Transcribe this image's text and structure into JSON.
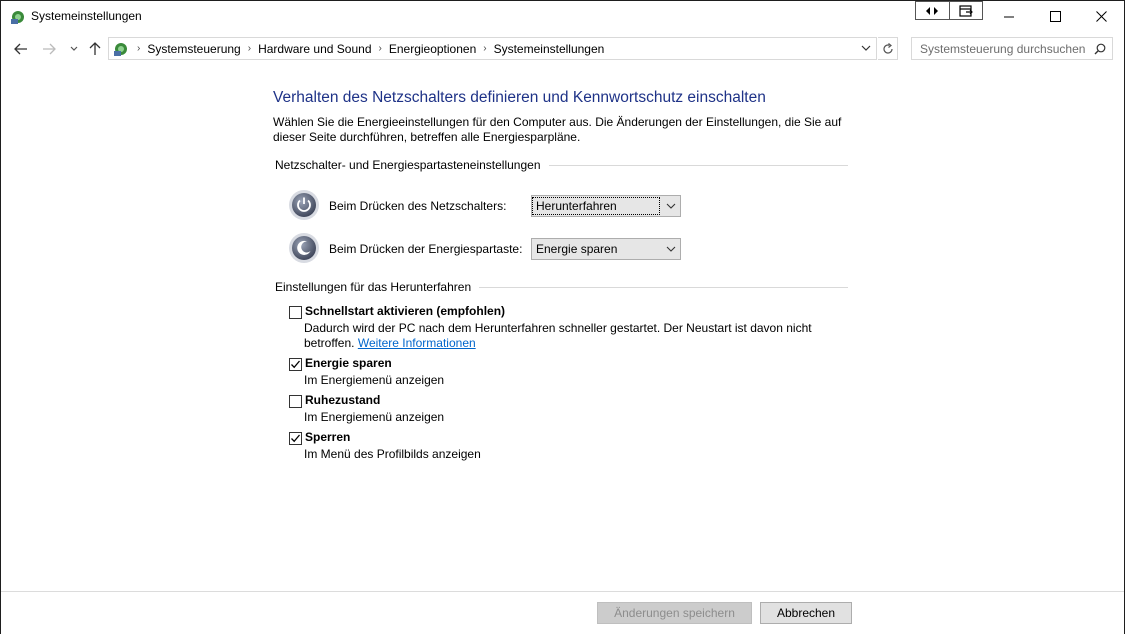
{
  "window": {
    "title": "Systemeinstellungen"
  },
  "address_bar": {
    "breadcrumbs": [
      "Systemsteuerung",
      "Hardware und Sound",
      "Energieoptionen",
      "Systemeinstellungen"
    ],
    "search_placeholder": "Systemsteuerung durchsuchen"
  },
  "main": {
    "title": "Verhalten des Netzschalters definieren und Kennwortschutz einschalten",
    "description": "Wählen Sie die Energieeinstellungen für den Computer aus. Die Änderungen der Einstellungen, die Sie auf dieser Seite durchführen, betreffen alle Energiesparpläne.",
    "power_section": {
      "heading": "Netzschalter- und Energiespartasteneinstellungen",
      "rows": [
        {
          "label": "Beim Drücken des Netzschalters:",
          "value": "Herunterfahren"
        },
        {
          "label": "Beim Drücken der Energiespartaste:",
          "value": "Energie sparen"
        }
      ]
    },
    "shutdown_section": {
      "heading": "Einstellungen für das Herunterfahren",
      "items": [
        {
          "label": "Schnellstart aktivieren (empfohlen)",
          "description": "Dadurch wird der PC nach dem Herunterfahren schneller gestartet. Der Neustart ist davon nicht betroffen.",
          "link": "Weitere Informationen",
          "checked": false
        },
        {
          "label": "Energie sparen",
          "description": "Im Energiemenü anzeigen",
          "checked": true
        },
        {
          "label": "Ruhezustand",
          "description": "Im Energiemenü anzeigen",
          "checked": false
        },
        {
          "label": "Sperren",
          "description": "Im Menü des Profilbilds anzeigen",
          "checked": true
        }
      ]
    }
  },
  "footer": {
    "save_label": "Änderungen speichern",
    "cancel_label": "Abbrechen"
  },
  "colors": {
    "title_blue": "#1e3287",
    "link_blue": "#0066cc"
  }
}
